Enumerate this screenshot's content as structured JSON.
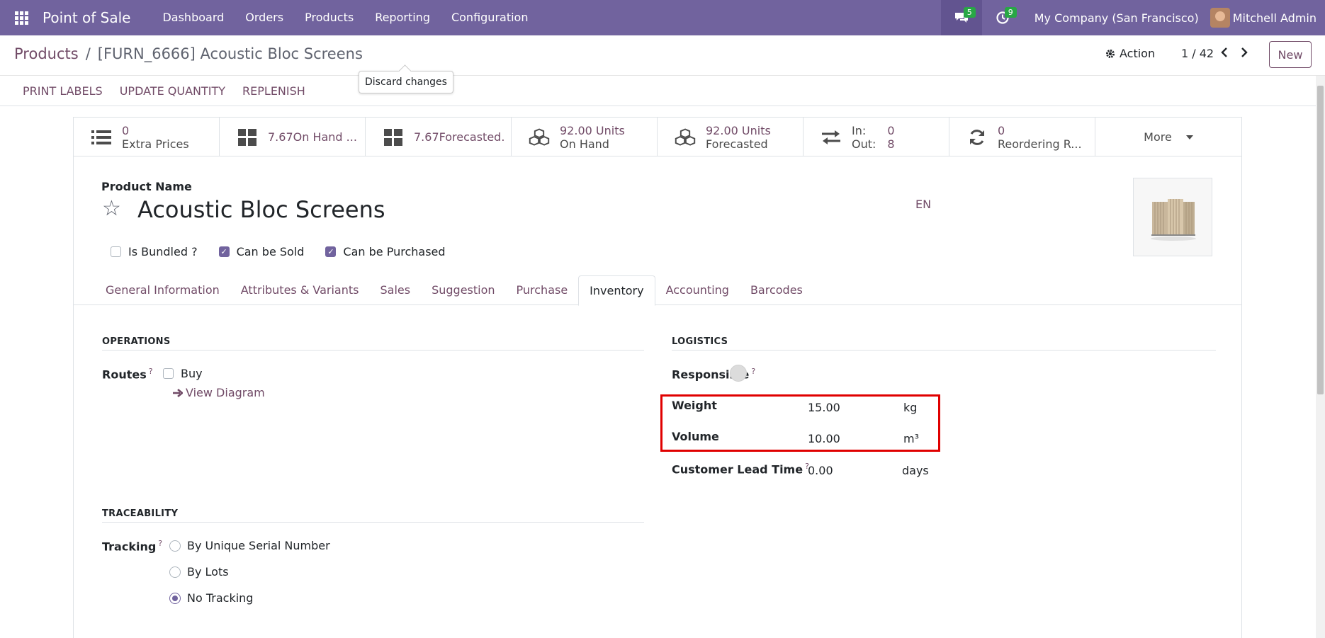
{
  "navbar": {
    "app_name": "Point of Sale",
    "menu": [
      "Dashboard",
      "Orders",
      "Products",
      "Reporting",
      "Configuration"
    ],
    "messages_count": "5",
    "activities_count": "9",
    "company": "My Company (San Francisco)",
    "user": "Mitchell Admin"
  },
  "control": {
    "breadcrumb_parent": "Products",
    "breadcrumb_sep": "/",
    "breadcrumb_current": "[FURN_6666] Acoustic Bloc Screens",
    "tooltip": "Discard changes",
    "action_label": "Action",
    "pager": "1 / 42",
    "new_label": "New"
  },
  "header_buttons": [
    "PRINT LABELS",
    "UPDATE QUANTITY",
    "REPLENISH"
  ],
  "stat_buttons": {
    "extra_prices": {
      "value": "0",
      "label": "Extra Prices"
    },
    "on_hand_short": "7.67On Hand ...",
    "forecasted_short": "7.67Forecasted.",
    "units_on_hand": {
      "value": "92.00 Units",
      "label": "On Hand"
    },
    "units_forecasted": {
      "value": "92.00 Units",
      "label": "Forecasted"
    },
    "in_out": {
      "in_label": "In:",
      "in_value": "0",
      "out_label": "Out:",
      "out_value": "8"
    },
    "reordering": {
      "value": "0",
      "label": "Reordering R..."
    },
    "more": "More"
  },
  "product": {
    "name_label": "Product Name",
    "name": "Acoustic Bloc Screens",
    "lang": "EN",
    "flags": [
      {
        "label": "Is Bundled ?",
        "checked": false
      },
      {
        "label": "Can be Sold",
        "checked": true
      },
      {
        "label": "Can be Purchased",
        "checked": true
      }
    ]
  },
  "tabs": [
    "General Information",
    "Attributes & Variants",
    "Sales",
    "Suggestion",
    "Purchase",
    "Inventory",
    "Accounting",
    "Barcodes"
  ],
  "active_tab": "Inventory",
  "operations": {
    "title": "OPERATIONS",
    "routes_label": "Routes",
    "help_mark": "?",
    "route_buy": "Buy",
    "view_diagram": "View Diagram"
  },
  "logistics": {
    "title": "LOGISTICS",
    "responsible_label": "Responsible",
    "weight_label": "Weight",
    "weight_value": "15.00",
    "weight_unit": "kg",
    "volume_label": "Volume",
    "volume_value": "10.00",
    "volume_unit": "m³",
    "lead_time_label": "Customer Lead Time",
    "lead_time_value": "0.00",
    "lead_time_unit": "days"
  },
  "traceability": {
    "title": "TRACEABILITY",
    "tracking_label": "Tracking",
    "options": [
      "By Unique Serial Number",
      "By Lots",
      "No Tracking"
    ],
    "selected": "No Tracking"
  },
  "colors": {
    "navbar": "#71639e",
    "accent": "#714b67",
    "highlight": "#e00000"
  }
}
